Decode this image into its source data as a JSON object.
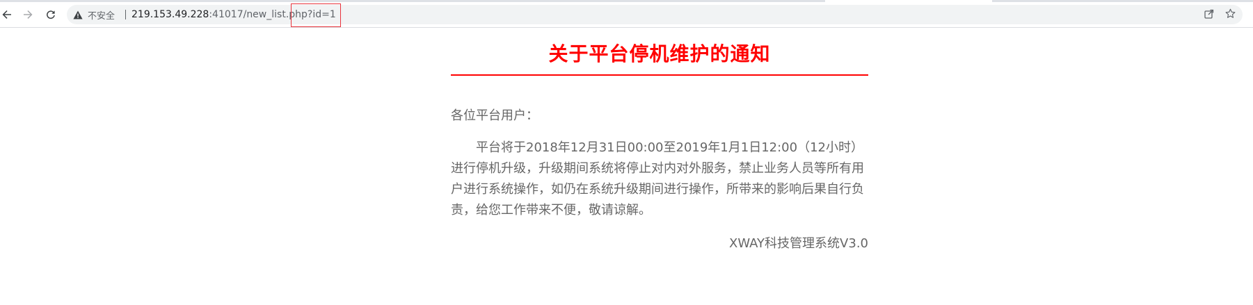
{
  "browser": {
    "security_label": "不安全",
    "url_host": "219.153.49.228",
    "url_rest": ":41017/new_list.php?id=1",
    "icons": {
      "back": "arrow-left-icon",
      "forward": "arrow-right-icon",
      "reload": "reload-icon",
      "warning": "warning-triangle-icon",
      "share": "share-icon",
      "bookmark": "star-icon"
    }
  },
  "notice": {
    "title": "关于平台停机维护的通知",
    "salutation": "各位平台用户：",
    "body": "平台将于2018年12月31日00:00至2019年1月1日12:00（12小时）进行停机升级，升级期间系统将停止对内对外服务，禁止业务人员等所有用户进行系统操作，如仍在系统升级期间进行操作，所带来的影响后果自行负责，给您工作带来不便，敬请谅解。",
    "signature": "XWAY科技管理系统V3.0"
  },
  "colors": {
    "title": "#ff0000",
    "text": "#666666",
    "highlight_box": "#e8323b"
  }
}
